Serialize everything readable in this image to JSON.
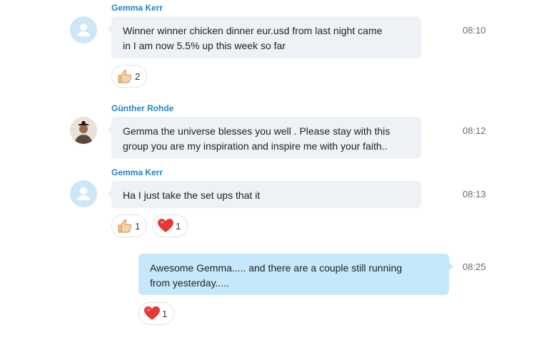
{
  "messages": [
    {
      "sender": "Gemma Kerr",
      "avatar_icon": "default-user-icon",
      "lines": [
        "Winner winner chicken dinner eur.usd from last night came",
        "in I am now 5.5% up this week so far"
      ],
      "time": "08:10",
      "reactions": [
        {
          "icon": "thumbs-up-icon",
          "count": "2"
        }
      ]
    },
    {
      "sender": "Günther Rohde",
      "avatar_icon": "user-photo",
      "lines": [
        "Gemma the universe blesses you well . Please stay with this",
        "group you are my inspiration and inspire me with your faith.."
      ],
      "time": "08:12",
      "reactions": []
    },
    {
      "sender": "Gemma Kerr",
      "avatar_icon": "default-user-icon",
      "lines": [
        "Ha I just take the set ups that it"
      ],
      "time": "08:13",
      "reactions": [
        {
          "icon": "thumbs-up-icon",
          "count": "1"
        },
        {
          "icon": "heart-icon",
          "count": "1"
        }
      ]
    },
    {
      "sender": "",
      "outgoing": true,
      "lines": [
        "Awesome Gemma..... and there are a couple still running",
        "from yesterday....."
      ],
      "time": "08:25",
      "reactions": [
        {
          "icon": "heart-icon",
          "count": "1"
        }
      ]
    }
  ],
  "colors": {
    "sender": "#1d85c6",
    "incoming_bubble": "#eef1f5",
    "outgoing_bubble": "#c5e9fb",
    "avatar_bg": "#cce8f8"
  }
}
